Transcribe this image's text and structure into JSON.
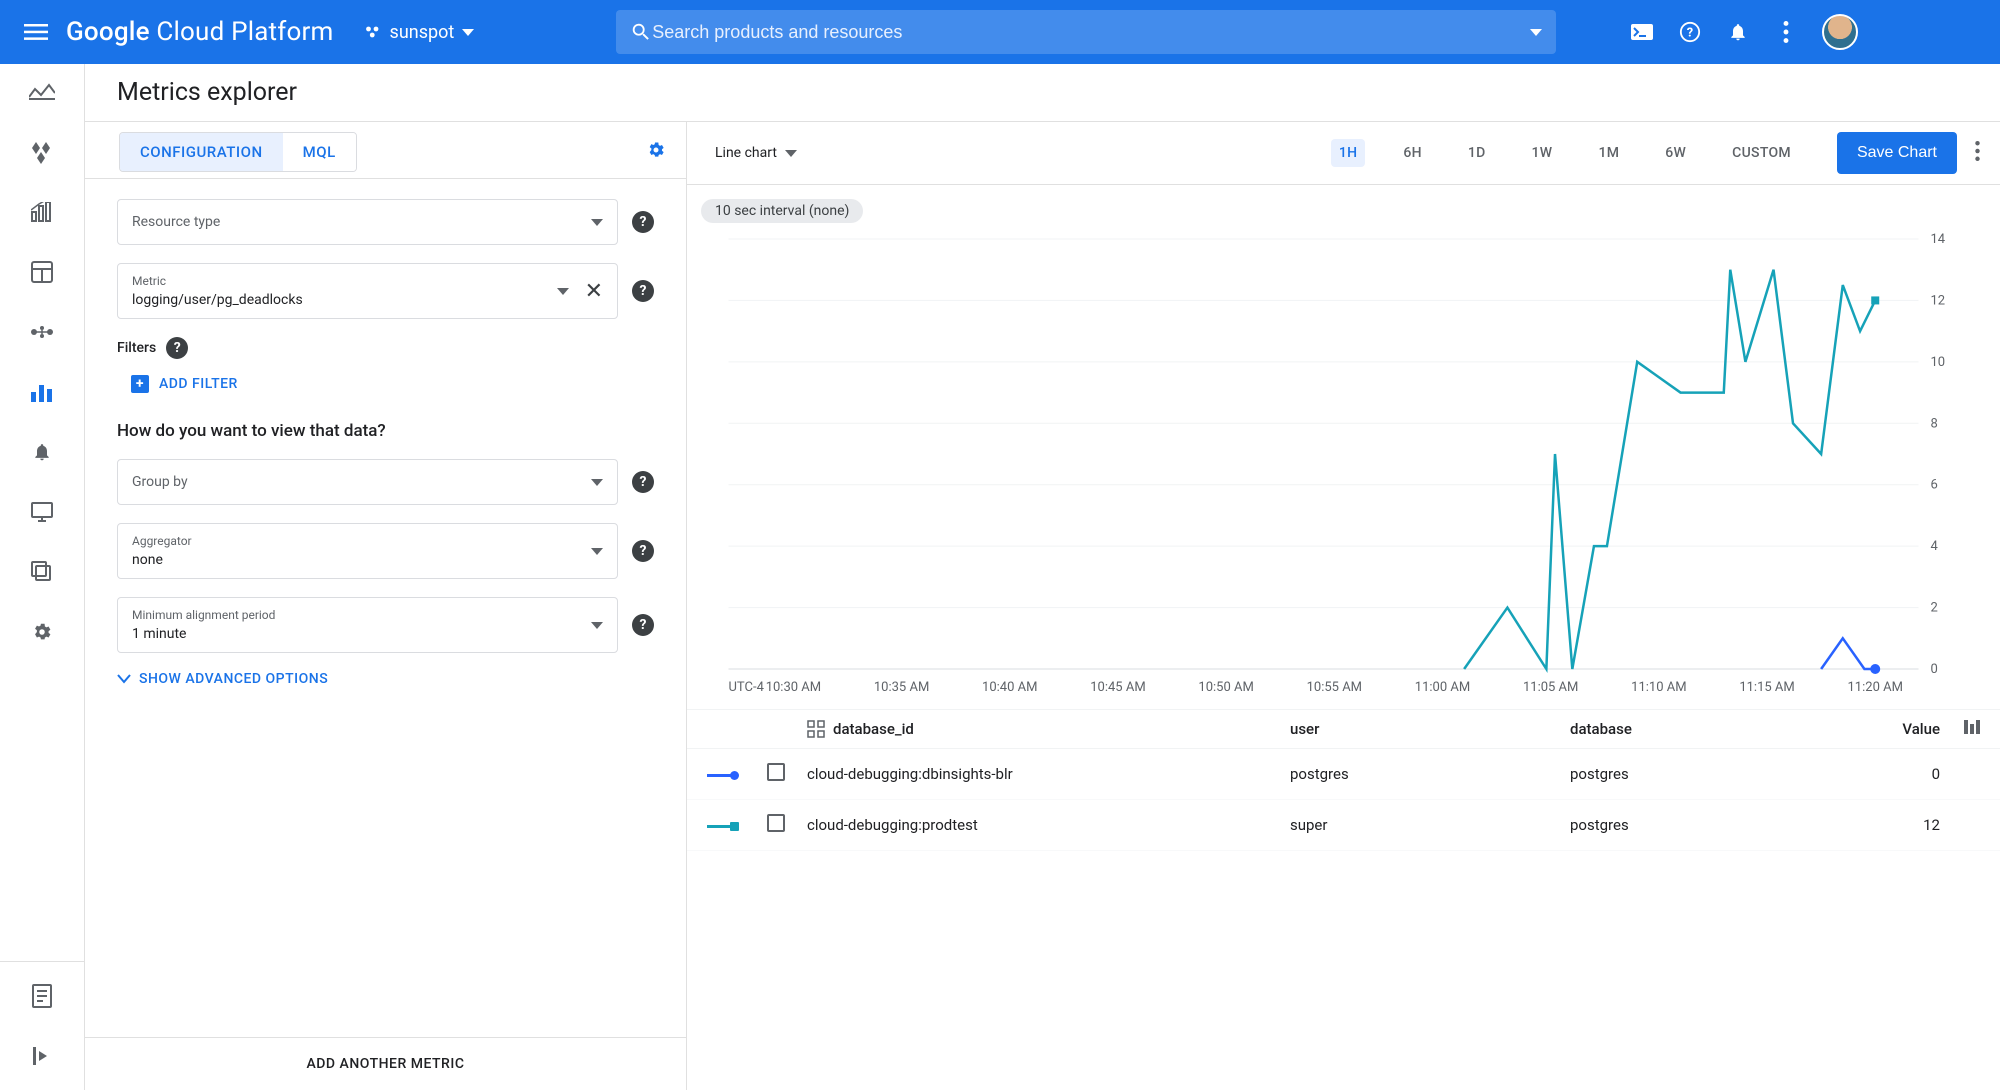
{
  "header": {
    "brand": "Google Cloud Platform",
    "project": "sunspot",
    "search_placeholder": "Search products and resources"
  },
  "page_title": "Metrics explorer",
  "config": {
    "tabs": {
      "configuration": "CONFIGURATION",
      "mql": "MQL"
    },
    "resource_type_placeholder": "Resource type",
    "metric_label": "Metric",
    "metric_value": "logging/user/pg_deadlocks",
    "filters_label": "Filters",
    "add_filter": "ADD FILTER",
    "view_question": "How do you want to view that data?",
    "group_by_placeholder": "Group by",
    "aggregator_label": "Aggregator",
    "aggregator_value": "none",
    "min_align_label": "Minimum alignment period",
    "min_align_value": "1 minute",
    "advanced": "SHOW ADVANCED OPTIONS",
    "add_metric": "ADD ANOTHER METRIC"
  },
  "chart_toolbar": {
    "type": "Line chart",
    "ranges": [
      "1H",
      "6H",
      "1D",
      "1W",
      "1M",
      "6W",
      "CUSTOM"
    ],
    "active_range": "1H",
    "save": "Save Chart",
    "chip": "10 sec interval (none)"
  },
  "chart_data": {
    "type": "line",
    "tz_label": "UTC-4",
    "x_labels": [
      "10:30 AM",
      "10:35 AM",
      "10:40 AM",
      "10:45 AM",
      "10:50 AM",
      "10:55 AM",
      "11:00 AM",
      "11:05 AM",
      "11:10 AM",
      "11:15 AM",
      "11:20 AM"
    ],
    "x": [
      30,
      35,
      40,
      45,
      50,
      55,
      60,
      65,
      70,
      75,
      80
    ],
    "y_ticks": [
      0,
      2,
      4,
      6,
      8,
      10,
      12,
      14
    ],
    "ylim": [
      0,
      14
    ],
    "xlim": [
      27,
      82
    ],
    "series": [
      {
        "name": "cloud-debugging:dbinsights-blr",
        "user": "postgres",
        "database": "postgres",
        "value": 0,
        "color": "#2962ff",
        "marker": "circle",
        "points": [
          [
            77.5,
            0
          ],
          [
            78.5,
            1
          ],
          [
            79.5,
            0
          ],
          [
            80,
            0
          ]
        ]
      },
      {
        "name": "cloud-debugging:prodtest",
        "user": "super",
        "database": "postgres",
        "value": 12,
        "color": "#16a2b8",
        "marker": "square",
        "points": [
          [
            61,
            0
          ],
          [
            63,
            2
          ],
          [
            64.8,
            0
          ],
          [
            65.2,
            7
          ],
          [
            66,
            0
          ],
          [
            67,
            4
          ],
          [
            67.6,
            4
          ],
          [
            69,
            10
          ],
          [
            71,
            9
          ],
          [
            73,
            9
          ],
          [
            73.3,
            13
          ],
          [
            74,
            10
          ],
          [
            75.3,
            13
          ],
          [
            76.2,
            8
          ],
          [
            77.5,
            7
          ],
          [
            78.5,
            12.5
          ],
          [
            79.3,
            11
          ],
          [
            80,
            12
          ]
        ]
      }
    ]
  },
  "legend": {
    "columns": {
      "db_id": "database_id",
      "user": "user",
      "database": "database",
      "value": "Value"
    }
  }
}
